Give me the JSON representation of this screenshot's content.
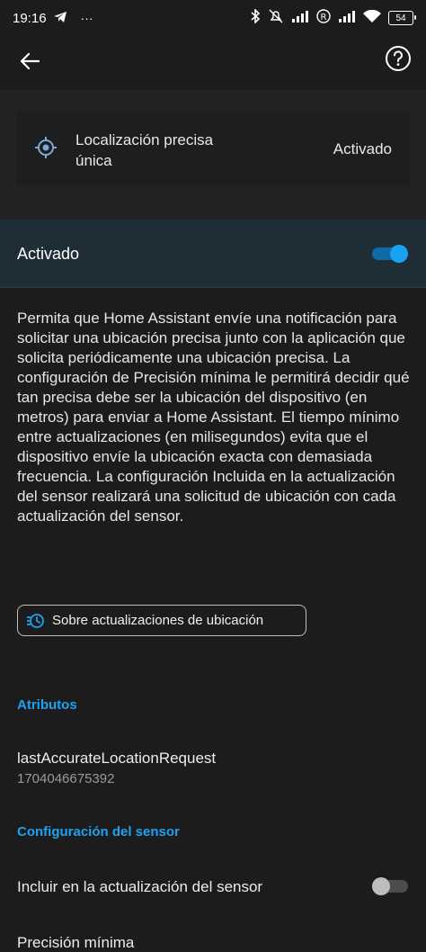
{
  "status_bar": {
    "time": "19:16",
    "overflow": "···",
    "battery": "54",
    "icons": [
      "telegram-icon",
      "bluetooth-icon",
      "mute-icon",
      "signal-icon",
      "roaming-icon",
      "signal-icon",
      "wifi-icon",
      "battery-icon"
    ]
  },
  "appbar": {
    "back_icon": "arrow-back-icon",
    "help_icon": "help-circle-icon"
  },
  "sensor": {
    "name": "Localización precisa única",
    "state": "Activado",
    "icon": "crosshairs-gps-icon"
  },
  "enable": {
    "label": "Activado",
    "enabled": true
  },
  "description": "Permita que Home Assistant envíe una notificación para solicitar una ubicación precisa junto con la aplicación que solicita periódicamente una ubicación precisa. La configuración de Precisión mínima le permitirá decidir qué tan precisa debe ser la ubicación del dispositivo (en metros) para enviar a Home Assistant. El tiempo mínimo entre actualizaciones (en milisegundos) evita que el dispositivo envíe la ubicación exacta con demasiada frecuencia. La configuración Incluida en la actualización del sensor realizará una solicitud de ubicación con cada actualización del sensor.",
  "chip": {
    "label": "Sobre actualizaciones de ubicación",
    "icon": "update-clock-icon"
  },
  "attributes": {
    "title": "Atributos",
    "items": [
      {
        "name": "lastAccurateLocationRequest",
        "value": "1704046675392"
      }
    ]
  },
  "settings": {
    "title": "Configuración del sensor",
    "include_label": "Incluir en la actualización del sensor",
    "include_enabled": false,
    "next_label": "Precisión mínima"
  },
  "colors": {
    "accent": "#1ea1f2",
    "toggle_on": "#1aa2f0",
    "background": "#1c1c1c"
  }
}
